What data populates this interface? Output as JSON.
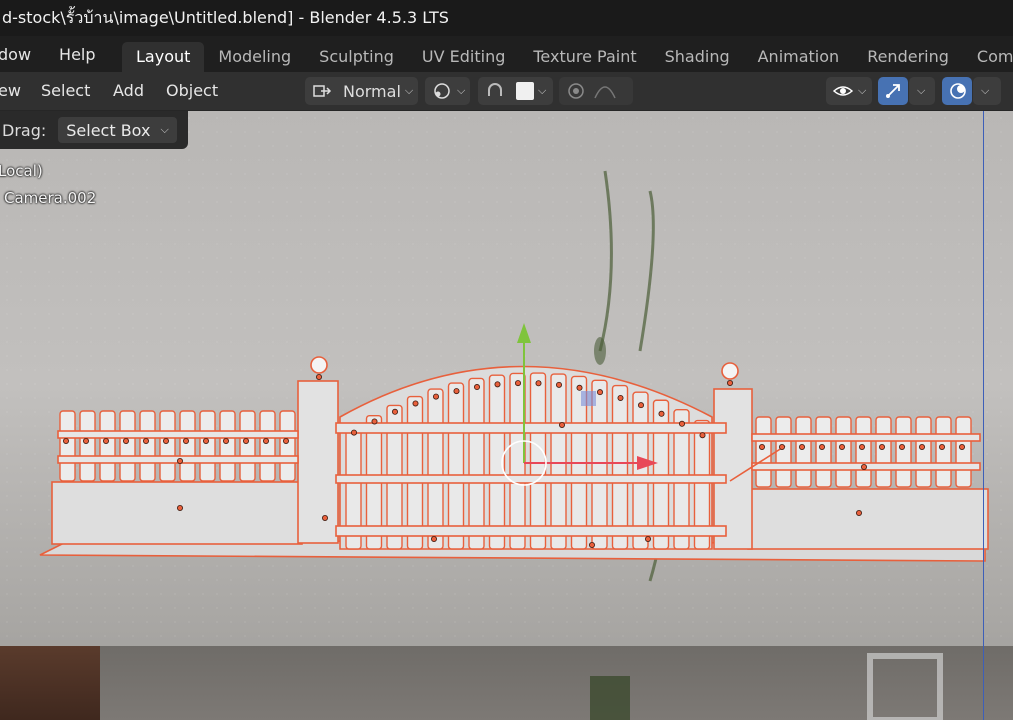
{
  "window": {
    "title": "d-stock\\รั้วบ้าน\\image\\Untitled.blend] - Blender 4.5.3 LTS"
  },
  "menu": {
    "items": [
      "dow",
      "Help"
    ]
  },
  "workspaces": {
    "tabs": [
      "Layout",
      "Modeling",
      "Sculpting",
      "UV Editing",
      "Texture Paint",
      "Shading",
      "Animation",
      "Rendering",
      "Comp"
    ],
    "active": "Layout"
  },
  "viewport_header": {
    "menus": [
      "ew",
      "Select",
      "Add",
      "Object"
    ],
    "orientation": "Normal"
  },
  "tool_settings": {
    "drag_label": "Drag:",
    "drag_value": "Select Box"
  },
  "overlay": {
    "view_name": "Local)",
    "object_name": "Camera.002"
  },
  "colors": {
    "selection": "#e8603c",
    "accent": "#4772b3",
    "gizmo_y": "#7fc43c",
    "gizmo_x": "#e84858"
  }
}
